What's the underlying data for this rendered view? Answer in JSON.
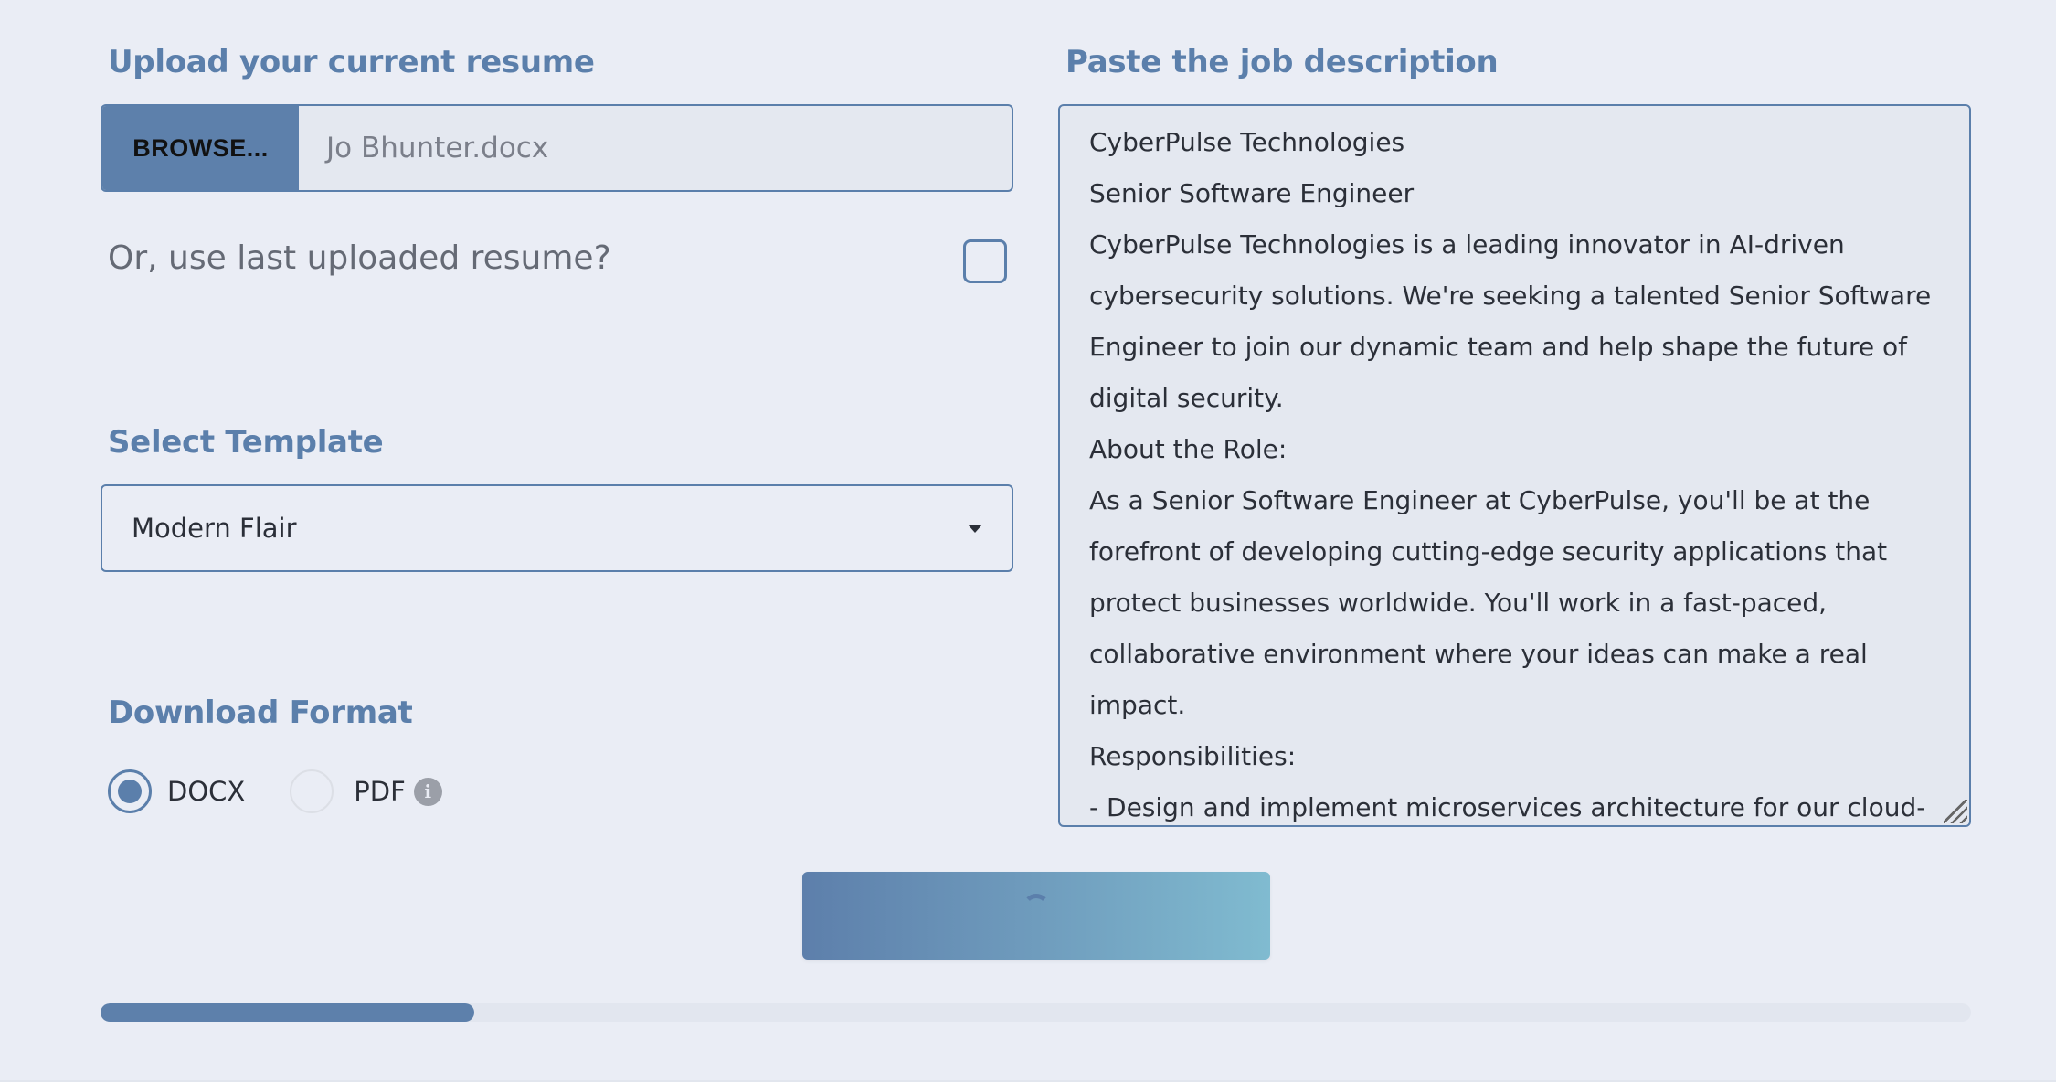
{
  "upload": {
    "heading": "Upload your current resume",
    "browse_label": "BROWSE...",
    "file_name": "Jo Bhunter.docx",
    "use_last_label": "Or, use last uploaded resume?",
    "use_last_checked": false
  },
  "template": {
    "heading": "Select Template",
    "selected": "Modern Flair"
  },
  "format": {
    "heading": "Download Format",
    "options": [
      {
        "label": "DOCX",
        "checked": true
      },
      {
        "label": "PDF",
        "checked": false,
        "info_icon": "info-icon"
      }
    ]
  },
  "job_description": {
    "heading": "Paste the job description",
    "lines": [
      "CyberPulse Technologies",
      "Senior Software Engineer",
      "CyberPulse Technologies is a leading innovator in AI-driven",
      "cybersecurity solutions. We're seeking a talented Senior Software",
      "Engineer to join our dynamic team and help shape the future of",
      "digital security.",
      "About the Role:",
      "As a Senior Software Engineer at CyberPulse, you'll be at the",
      "forefront of developing cutting-edge security applications that",
      "protect businesses worldwide. You'll work in a fast-paced,",
      "collaborative environment where your ideas can make a real",
      "impact.",
      "Responsibilities:",
      "- Design and implement microservices architecture for our cloud-"
    ]
  },
  "generate_button": {
    "state": "loading",
    "icon": "spinner-icon"
  },
  "progress": {
    "percent": 20
  },
  "colors": {
    "accent": "#5b7fab",
    "background": "#eaedf5",
    "button_gradient_start": "#5d7fab",
    "button_gradient_end": "#80bbd0"
  }
}
